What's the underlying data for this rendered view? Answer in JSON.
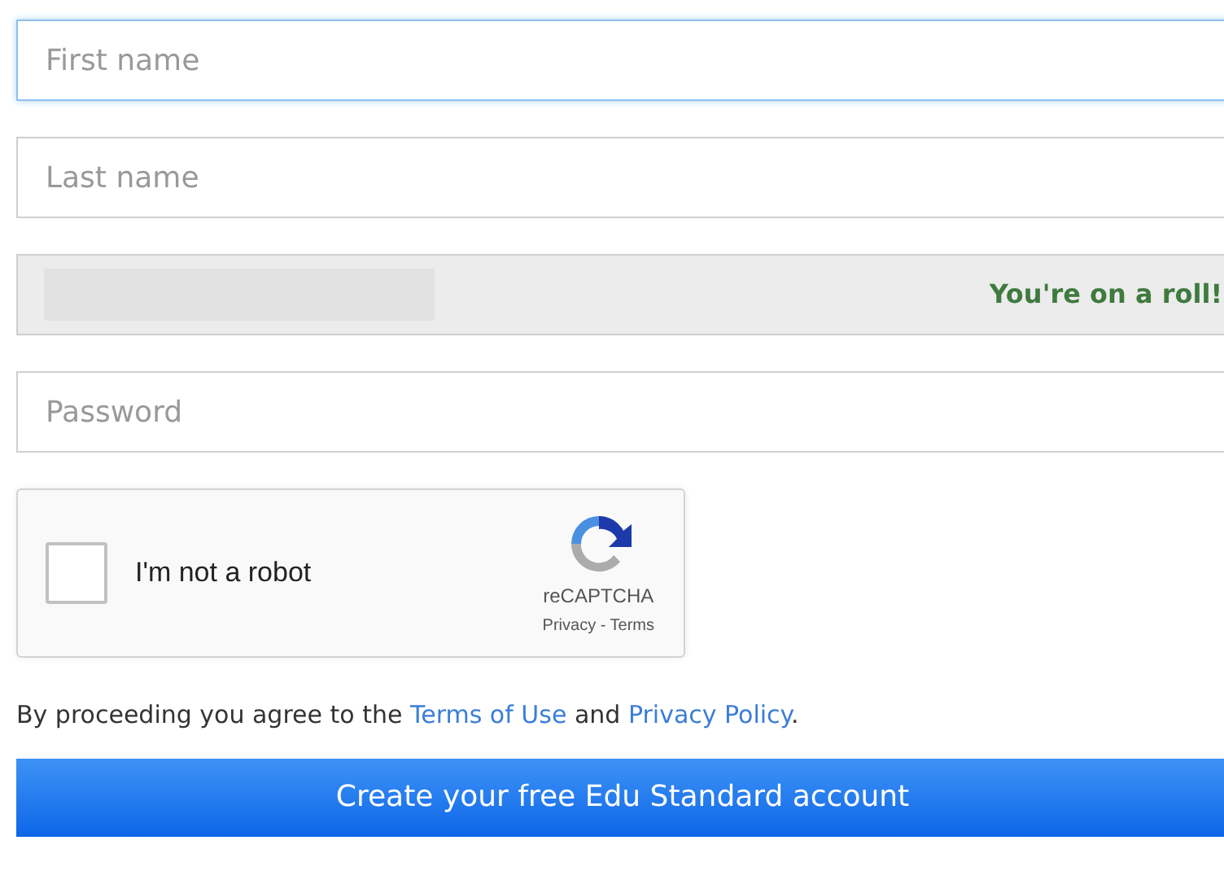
{
  "fields": [
    {
      "kind": "input",
      "placeholder": "First name",
      "focused": true
    },
    {
      "kind": "input",
      "placeholder": "Last name",
      "focused": false
    },
    {
      "kind": "status",
      "message": "You're on a roll!",
      "focused": false
    },
    {
      "kind": "input",
      "placeholder": "Password",
      "focused": false
    }
  ],
  "captcha": {
    "label": "I'm not a robot",
    "checked": false,
    "brand": "reCAPTCHA",
    "links": "Privacy - Terms"
  },
  "agreement": {
    "before": "By proceeding you agree to the ",
    "terms_link": "Terms of Use",
    "middle": " and ",
    "privacy_link": "Privacy Policy",
    "after": "."
  },
  "submit_button": "Create your free Edu Standard account"
}
